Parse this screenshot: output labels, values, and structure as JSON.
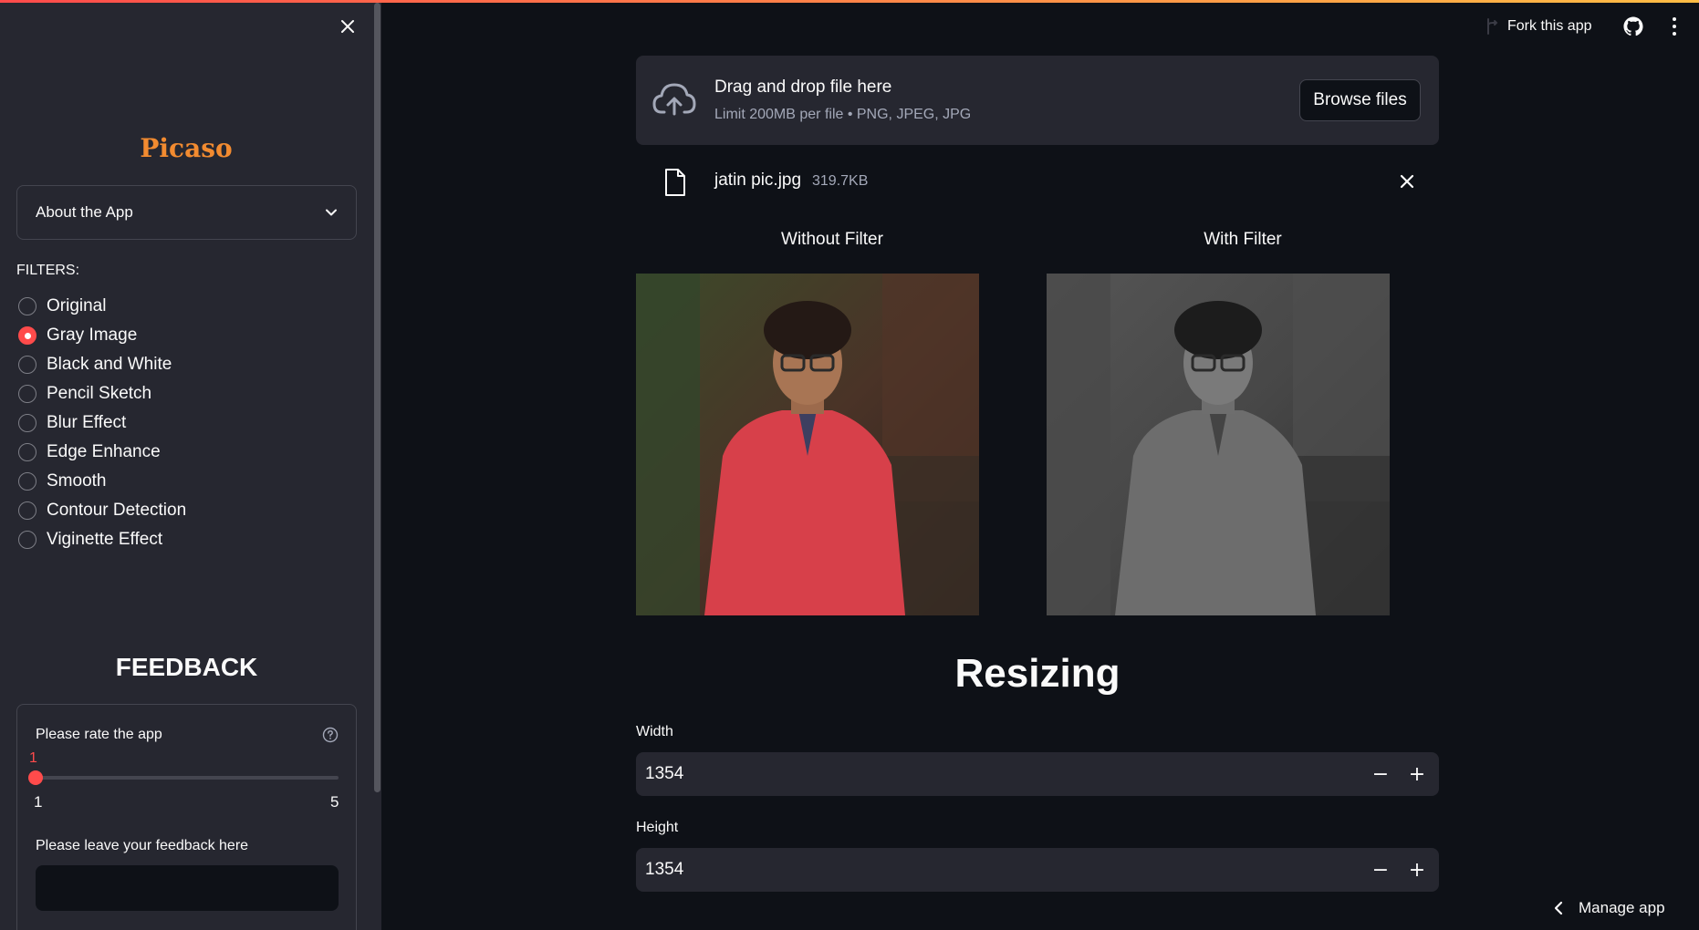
{
  "header": {
    "fork_label": "Fork this app",
    "icons": [
      "fork-icon",
      "github-icon",
      "kebab-menu-icon"
    ]
  },
  "sidebar": {
    "title": "Picaso",
    "expander_label": "About the App",
    "filters_label": "FILTERS:",
    "filters": [
      {
        "label": "Original",
        "checked": false
      },
      {
        "label": "Gray Image",
        "checked": true
      },
      {
        "label": "Black and White",
        "checked": false
      },
      {
        "label": "Pencil Sketch",
        "checked": false
      },
      {
        "label": "Blur Effect",
        "checked": false
      },
      {
        "label": "Edge Enhance",
        "checked": false
      },
      {
        "label": "Smooth",
        "checked": false
      },
      {
        "label": "Contour Detection",
        "checked": false
      },
      {
        "label": "Viginette Effect",
        "checked": false
      }
    ],
    "feedback": {
      "heading": "FEEDBACK",
      "rate_label": "Please rate the app",
      "rating_value": "1",
      "rating_min": "1",
      "rating_max": "5",
      "feedback_label": "Please leave your feedback here",
      "feedback_value": ""
    }
  },
  "uploader": {
    "title": "Drag and drop file here",
    "limit": "Limit 200MB per file • PNG, JPEG, JPG",
    "browse_label": "Browse files",
    "file_name": "jatin pic.jpg",
    "file_size": "319.7KB"
  },
  "comparison": {
    "without_label": "Without Filter",
    "with_label": "With Filter"
  },
  "resizing": {
    "heading": "Resizing",
    "width_label": "Width",
    "width_value": "1354",
    "height_label": "Height",
    "height_value": "1354",
    "minus": "−",
    "plus": "+"
  },
  "footer": {
    "manage_label": "Manage app"
  },
  "colors": {
    "primary": "#ff4b4b",
    "brand_title": "#f28b30",
    "background": "#0e1117",
    "sidebar": "#262730"
  }
}
